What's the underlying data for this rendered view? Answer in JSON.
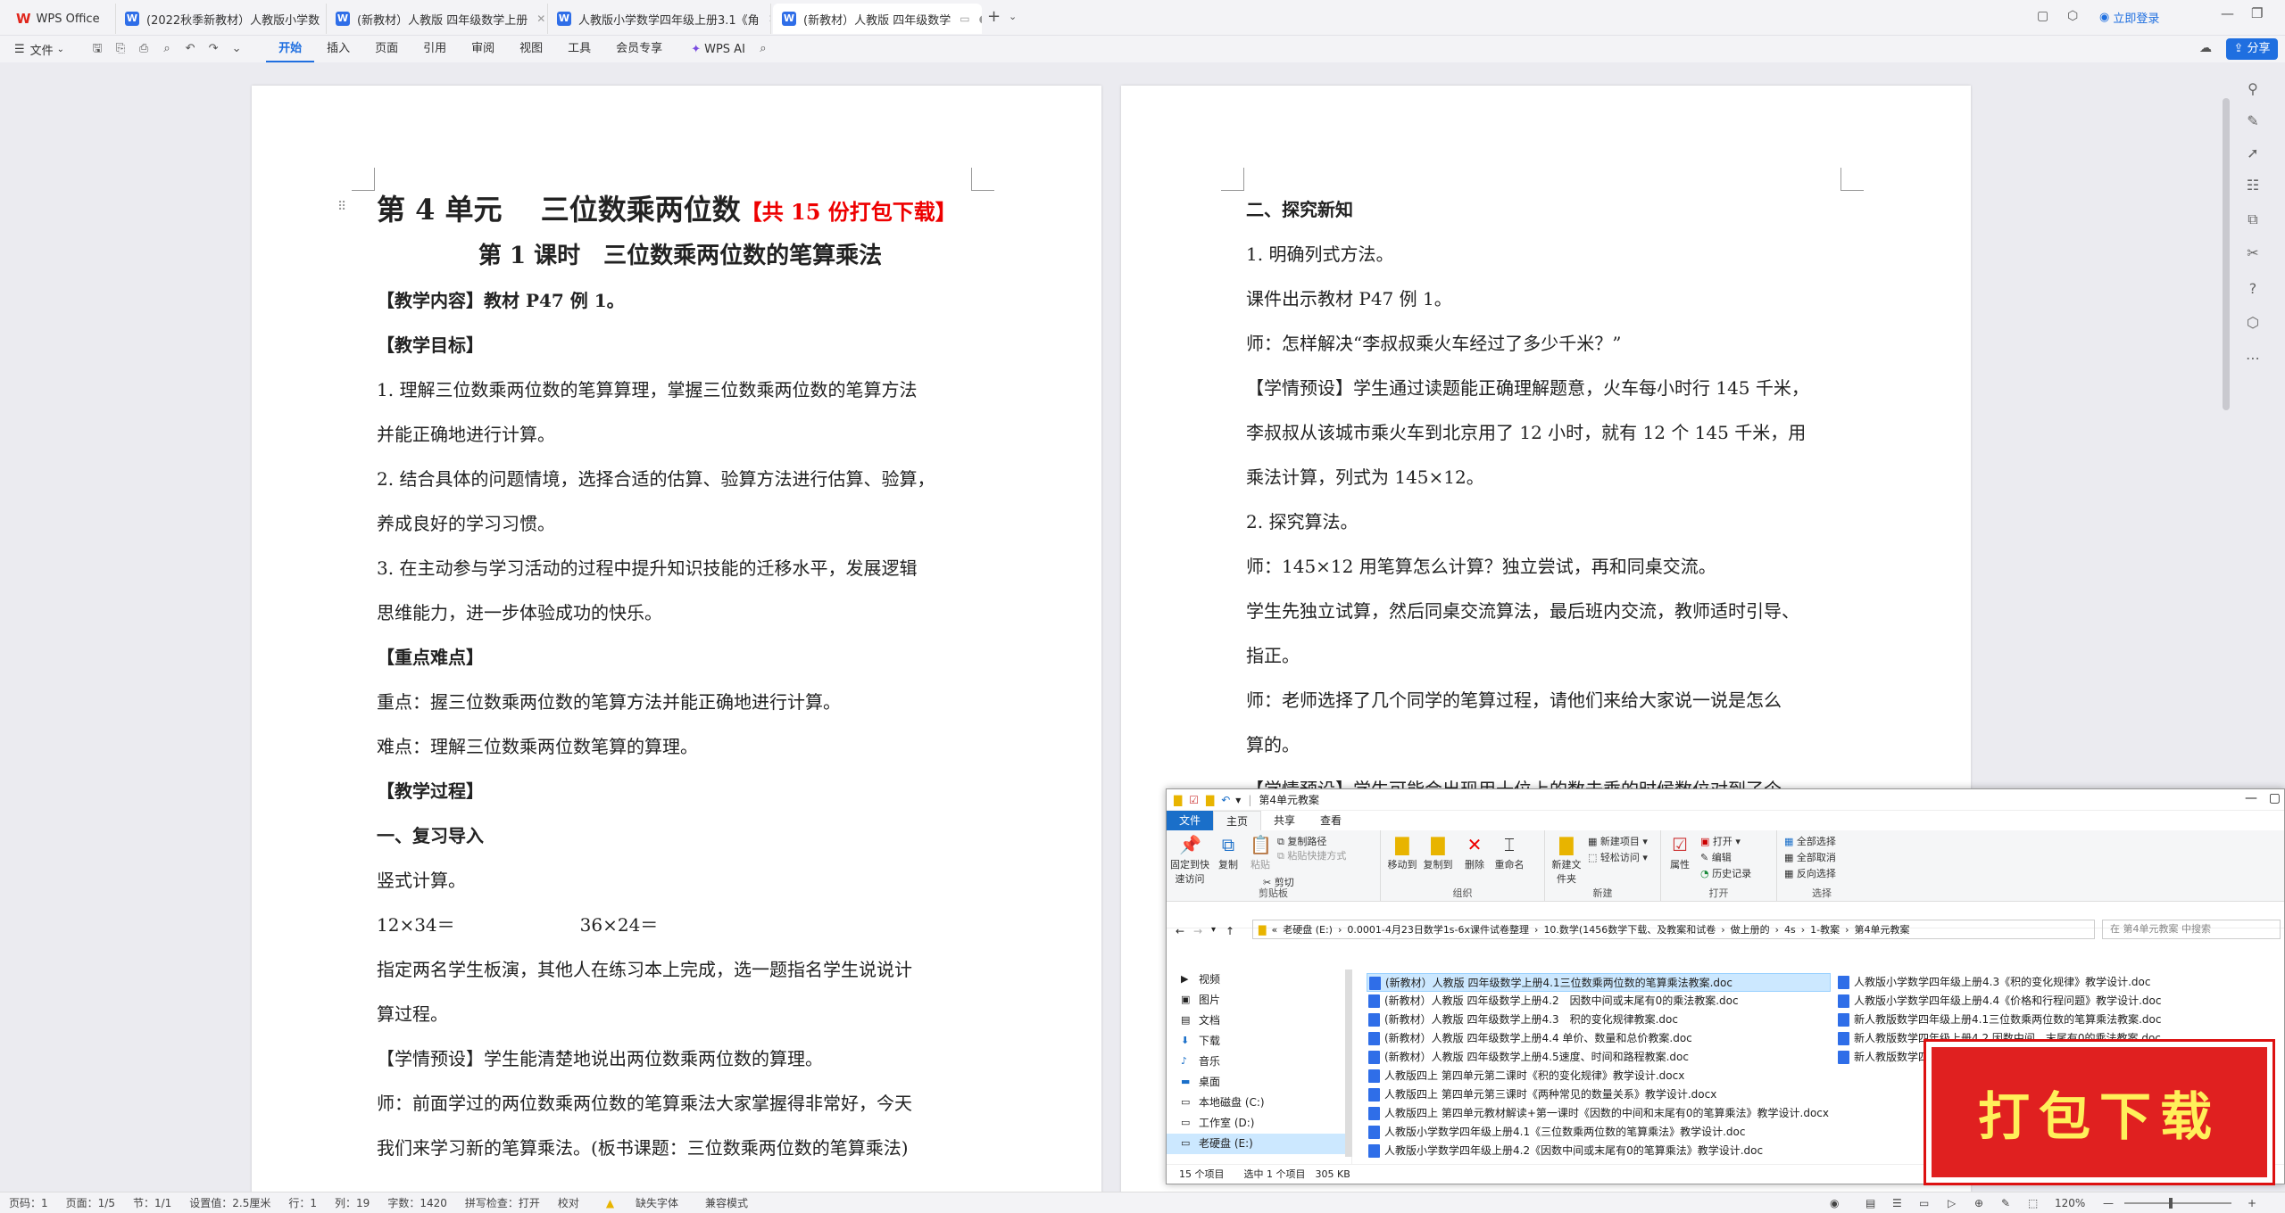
{
  "titlebar": {
    "app_name": "WPS Office",
    "tabs": [
      {
        "label": "(2022秋季新教材）人教版小学数"
      },
      {
        "label": "(新教材）人教版 四年级数学上册"
      },
      {
        "label": "人教版小学数学四年级上册3.1《角"
      },
      {
        "label": "(新教材）人教版 四年级数学"
      }
    ],
    "login_label": "立即登录"
  },
  "toolbar": {
    "file_label": "文件",
    "menus": [
      "开始",
      "插入",
      "页面",
      "引用",
      "审阅",
      "视图",
      "工具",
      "会员专享"
    ],
    "wps_ai_label": "WPS AI",
    "share_label": "分享"
  },
  "page_left": {
    "title": "第 4 单元　 三位数乘两位数",
    "title_suffix": "【共 15 份打包下载】",
    "subtitle": "第 1 课时　三位数乘两位数的笔算乘法",
    "lines": [
      "【教学内容】教材 P47 例 1。",
      "【教学目标】",
      "1. 理解三位数乘两位数的笔算算理，掌握三位数乘两位数的笔算方法",
      "并能正确地进行计算。",
      "2. 结合具体的问题情境，选择合适的估算、验算方法进行估算、验算，",
      "养成良好的学习习惯。",
      "3. 在主动参与学习活动的过程中提升知识技能的迁移水平，发展逻辑",
      "思维能力，进一步体验成功的快乐。",
      "【重点难点】",
      "重点：握三位数乘两位数的笔算方法并能正确地进行计算。",
      "难点：理解三位数乘两位数笔算的算理。",
      "【教学过程】",
      "一、复习导入",
      "竖式计算。",
      "12×34＝　　　　　　　36×24＝",
      "指定两名学生板演，其他人在练习本上完成，选一题指名学生说说计",
      "算过程。",
      "【学情预设】学生能清楚地说出两位数乘两位数的算理。",
      "师：前面学过的两位数乘两位数的笔算乘法大家掌握得非常好，今天",
      "我们来学习新的笔算乘法。(板书课题：三位数乘两位数的笔算乘法)"
    ]
  },
  "page_right": {
    "lines": [
      "二、探究新知",
      "1. 明确列式方法。",
      "课件出示教材 P47 例 1。",
      "师：怎样解决“李叔叔乘火车经过了多少千米？”",
      "【学情预设】学生通过读题能正确理解题意，火车每小时行 145 千米，",
      "李叔叔从该城市乘火车到北京用了 12 小时，就有 12 个 145 千米，用",
      "乘法计算，列式为 145×12。",
      "2. 探究算法。",
      "师：145×12 用笔算怎么计算？独立尝试，再和同桌交流。",
      "学生先独立试算，然后同桌交流算法，最后班内交流，教师适时引导、",
      "指正。",
      "师：老师选择了几个同学的笔算过程，请他们来给大家说一说是怎么",
      "算的。",
      "【学情预设】学生可能会出现用十位上的数去乘的时候数位对到了个"
    ]
  },
  "explorer": {
    "title": "第4单元教案",
    "tabs": [
      "文件",
      "主页",
      "共享",
      "查看"
    ],
    "ribbon": {
      "pin_label": "固定到快速访问",
      "copy_label": "复制",
      "paste_label": "粘贴",
      "copy_path_label": "复制路径",
      "paste_shortcut_label": "粘贴快捷方式",
      "cut_label": "剪切",
      "clipboard_group": "剪贴板",
      "move_to_label": "移动到",
      "copy_to_label": "复制到",
      "delete_label": "删除",
      "rename_label": "重命名",
      "organize_group": "组织",
      "new_folder_label": "新建文件夹",
      "new_item_label": "新建项目",
      "easy_access_label": "轻松访问",
      "new_group": "新建",
      "properties_label": "属性",
      "open_label": "打开",
      "edit_label": "编辑",
      "history_label": "历史记录",
      "open_group": "打开",
      "select_all_label": "全部选择",
      "select_none_label": "全部取消",
      "invert_label": "反向选择",
      "select_group": "选择"
    },
    "breadcrumb": [
      "老硬盘 (E:)",
      "0.0001-4月23日数学1s-6x课件试卷整理",
      "10.数学(1456数学下载、及教案和试卷",
      "做上册的",
      "4s",
      "1-教案",
      "第4单元教案"
    ],
    "search_placeholder": "在 第4单元教案 中搜索",
    "nav": [
      "视频",
      "图片",
      "文档",
      "下载",
      "音乐",
      "桌面",
      "本地磁盘 (C:)",
      "工作室 (D:)",
      "老硬盘 (E:)"
    ],
    "files_col1": [
      "(新教材）人教版 四年级数学上册4.1三位数乘两位数的笔算乘法教案.doc",
      "(新教材）人教版 四年级数学上册4.2　因数中间或末尾有0的乘法教案.doc",
      "(新教材）人教版 四年级数学上册4.3　积的变化规律教案.doc",
      "(新教材）人教版 四年级数学上册4.4 单价、数量和总价教案.doc",
      "(新教材）人教版 四年级数学上册4.5速度、时间和路程教案.doc",
      "人教版四上 第四单元第二课时《积的变化规律》教学设计.docx",
      "人教版四上 第四单元第三课时《两种常见的数量关系》教学设计.docx",
      "人教版四上 第四单元教材解读+第一课时《因数的中间和末尾有0的笔算乘法》教学设计.docx",
      "人教版小学数学四年级上册4.1《三位数乘两位数的笔算乘法》教学设计.doc",
      "人教版小学数学四年级上册4.2《因数中间或末尾有0的笔算乘法》教学设计.doc"
    ],
    "files_col2": [
      "人教版小学数学四年级上册4.3《积的变化规律》教学设计.doc",
      "人教版小学数学四年级上册4.4《价格和行程问题》教学设计.doc",
      "新人教版数学四年级上册4.1三位数乘两位数的笔算乘法教案.doc",
      "新人教版数学四年级上册4.2 因数中间、末尾有0的乘法教案.doc",
      "新人教版数学四年级上册4.3积的变化规律"
    ],
    "status": "15 个项目　　选中 1 个项目　305 KB"
  },
  "promo_label": "打包下载",
  "statusbar": {
    "items": [
      "页码：1",
      "页面：1/5",
      "节：1/1",
      "设置值：2.5厘米",
      "行：1",
      "列：19",
      "字数：1420",
      "拼写检查：打开",
      "校对",
      "缺失字体",
      "兼容模式"
    ],
    "zoom": "120%"
  },
  "colors": {
    "accent": "#1f6fe0",
    "red": "#e00000",
    "wps_red": "#e0251b"
  }
}
